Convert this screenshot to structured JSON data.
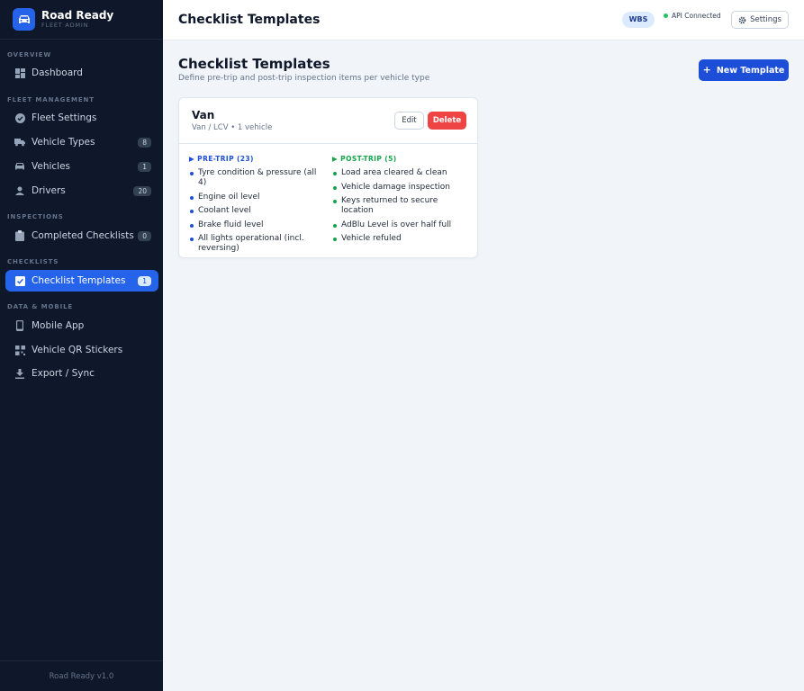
{
  "brand": {
    "name": "Road Ready",
    "subtitle": "FLEET ADMIN"
  },
  "sidebar": {
    "sections": [
      {
        "label": "OVERVIEW"
      },
      {
        "label": "FLEET MANAGEMENT"
      },
      {
        "label": "INSPECTIONS"
      },
      {
        "label": "CHECKLISTS"
      },
      {
        "label": "DATA & MOBILE"
      }
    ],
    "items": [
      {
        "label": "Dashboard",
        "icon": "dashboard-icon"
      },
      {
        "label": "Fleet Settings",
        "icon": "check-circle-icon"
      },
      {
        "label": "Vehicle Types",
        "icon": "truck-icon",
        "badge": "8"
      },
      {
        "label": "Vehicles",
        "icon": "car-icon",
        "badge": "1"
      },
      {
        "label": "Drivers",
        "icon": "user-icon",
        "badge": "20"
      },
      {
        "label": "Completed Checklists",
        "icon": "clipboard-icon",
        "badge": "0"
      },
      {
        "label": "Checklist Templates",
        "icon": "checkbox-icon",
        "badge": "1",
        "active": true
      },
      {
        "label": "Mobile App",
        "icon": "phone-icon"
      },
      {
        "label": "Vehicle QR Stickers",
        "icon": "qr-icon"
      },
      {
        "label": "Export / Sync",
        "icon": "download-icon"
      }
    ],
    "footer": "Road Ready v1.0"
  },
  "header": {
    "title": "Checklist Templates",
    "org_badge": "WBS",
    "api_status": "API Connected",
    "settings_label": "Settings"
  },
  "main": {
    "title": "Checklist Templates",
    "subtitle": "Define pre-trip and post-trip inspection items per vehicle type",
    "new_button": "New Template"
  },
  "template": {
    "name": "Van",
    "meta": "Van / LCV • 1 vehicle",
    "edit_label": "Edit",
    "delete_label": "Delete",
    "pre_trip": {
      "heading": "▶ PRE-TRIP (23)",
      "items": [
        "Tyre condition & pressure (all 4)",
        "Engine oil level",
        "Coolant level",
        "Brake fluid level",
        "All lights operational (incl. reversing)"
      ]
    },
    "post_trip": {
      "heading": "▶ POST-TRIP (5)",
      "items": [
        "Load area cleared & clean",
        "Vehicle damage inspection",
        "Keys returned to secure location",
        "AdBlu Level is over half full",
        "Vehicle refuled"
      ]
    }
  },
  "colors": {
    "sidebar_bg": "#0f172a",
    "accent": "#2563eb",
    "danger": "#ef4444",
    "success": "#16a34a"
  }
}
